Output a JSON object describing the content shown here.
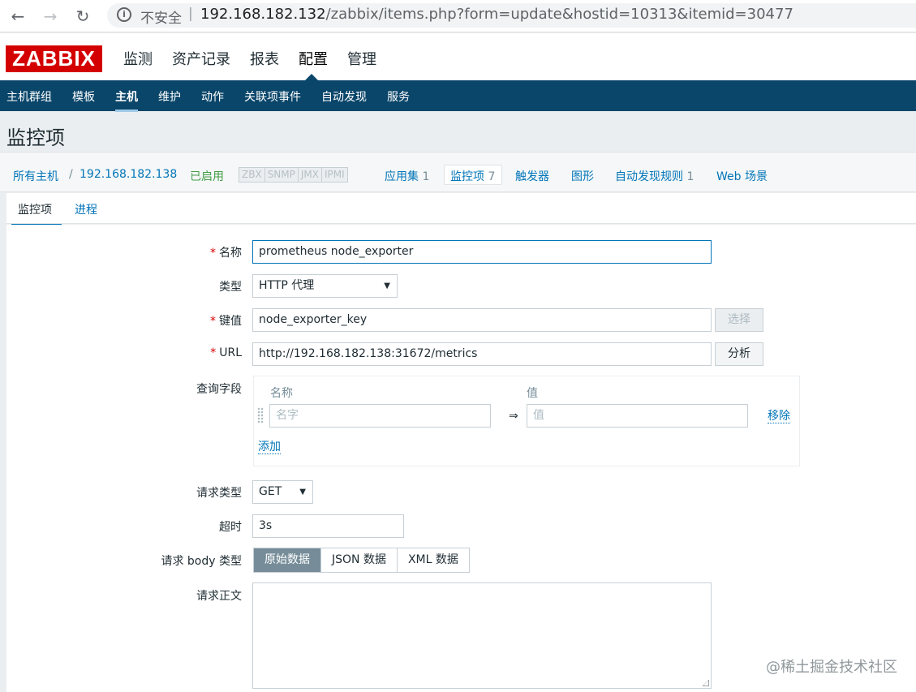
{
  "browser": {
    "insecure_label": "不安全",
    "separator": "|",
    "url_host": "192.168.182.132",
    "url_path": "/zabbix/items.php?form=update&hostid=10313&itemid=30477"
  },
  "header": {
    "logo": "ZABBIX",
    "menu": [
      "监测",
      "资产记录",
      "报表",
      "配置",
      "管理"
    ]
  },
  "submenu": [
    "主机群组",
    "模板",
    "主机",
    "维护",
    "动作",
    "关联项事件",
    "自动发现",
    "服务"
  ],
  "page_title": "监控项",
  "host_nav": {
    "all_hosts": "所有主机",
    "sep": "/",
    "host": "192.168.182.138",
    "status": "已启用",
    "availability": [
      "ZBX",
      "SNMP",
      "JMX",
      "IPMI"
    ],
    "apps_label": "应用集",
    "apps_count": "1",
    "items_label": "监控项",
    "items_count": "7",
    "triggers": "触发器",
    "graphs": "图形",
    "discovery_label": "自动发现规则",
    "discovery_count": "1",
    "web": "Web 场景"
  },
  "form_tabs": [
    "监控项",
    "进程"
  ],
  "form": {
    "name_label": "名称",
    "name_value": "prometheus node_exporter",
    "type_label": "类型",
    "type_value": "HTTP 代理",
    "key_label": "键值",
    "key_value": "node_exporter_key",
    "key_select_button": "选择",
    "url_label": "URL",
    "url_value": "http://192.168.182.138:31672/metrics",
    "url_parse_button": "分析",
    "query_label": "查询字段",
    "query_name_header": "名称",
    "query_value_header": "值",
    "query_name_placeholder": "名字",
    "query_value_placeholder": "值",
    "query_arrow": "⇒",
    "query_remove": "移除",
    "query_add": "添加",
    "request_type_label": "请求类型",
    "request_type_value": "GET",
    "timeout_label": "超时",
    "timeout_value": "3s",
    "body_type_label": "请求 body 类型",
    "body_types": [
      "原始数据",
      "JSON 数据",
      "XML 数据"
    ],
    "body_label": "请求正文"
  },
  "watermark": "@稀土掘金技术社区"
}
